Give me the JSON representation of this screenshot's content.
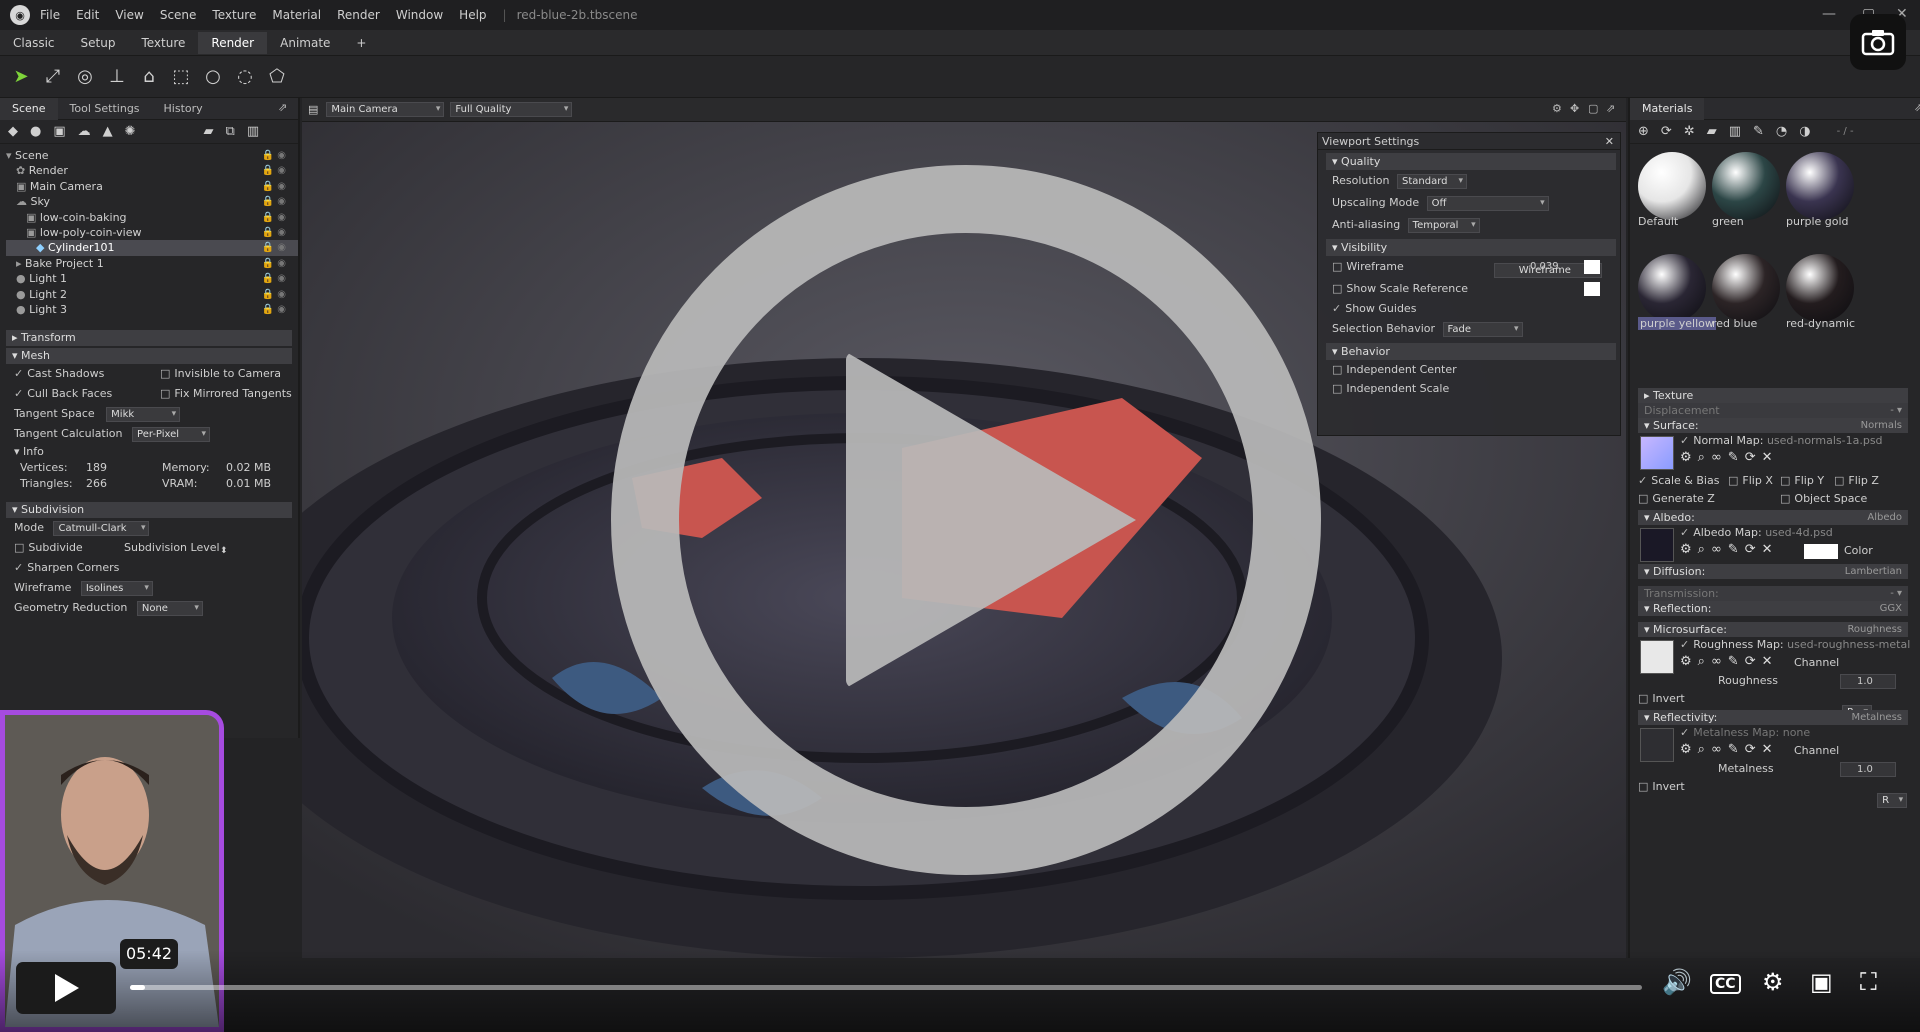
{
  "titlebar": {
    "menu": [
      "File",
      "Edit",
      "View",
      "Scene",
      "Texture",
      "Material",
      "Render",
      "Window",
      "Help"
    ],
    "filename": "red-blue-2b.tbscene"
  },
  "tabs": [
    "Classic",
    "Setup",
    "Texture",
    "Render",
    "Animate",
    "+"
  ],
  "active_tab": "Render",
  "left_panel": {
    "tabs": [
      "Scene",
      "Tool Settings",
      "History"
    ],
    "tree": [
      {
        "label": "Scene",
        "indent": 0
      },
      {
        "label": "Render",
        "indent": 1
      },
      {
        "label": "Main Camera",
        "indent": 1
      },
      {
        "label": "Sky",
        "indent": 1
      },
      {
        "label": "low-coin-baking",
        "indent": 2
      },
      {
        "label": "low-poly-coin-view",
        "indent": 2
      },
      {
        "label": "Cylinder101",
        "indent": 3,
        "selected": true
      },
      {
        "label": "Bake Project 1",
        "indent": 1
      },
      {
        "label": "Light 1",
        "indent": 1
      },
      {
        "label": "Light 2",
        "indent": 1
      },
      {
        "label": "Light 3",
        "indent": 1
      }
    ],
    "sections": {
      "transform": "Transform",
      "mesh": "Mesh",
      "info": "Info",
      "subdivision": "Subdivision"
    },
    "mesh": {
      "cast_shadows": "Cast Shadows",
      "invisible_to_camera": "Invisible to Camera",
      "cull_back_faces": "Cull Back Faces",
      "fix_mirrored": "Fix Mirrored Tangents",
      "tangent_space_label": "Tangent Space",
      "tangent_space_value": "Mikk",
      "tangent_calc_label": "Tangent Calculation",
      "tangent_calc_value": "Per-Pixel"
    },
    "info": {
      "vertices_label": "Vertices:",
      "vertices": "189",
      "triangles_label": "Triangles:",
      "triangles": "266",
      "memory_label": "Memory:",
      "memory": "0.02 MB",
      "vram_label": "VRAM:",
      "vram": "0.01 MB"
    },
    "subdivision": {
      "mode_label": "Mode",
      "mode_value": "Catmull-Clark",
      "subdivide": "Subdivide",
      "level_label": "Subdivision Level",
      "level_value": "1",
      "sharpen": "Sharpen Corners",
      "wireframe_label": "Wireframe",
      "wireframe_value": "Isolines",
      "geo_label": "Geometry Reduction",
      "geo_value": "None"
    }
  },
  "viewport": {
    "camera": "Main Camera",
    "quality": "Full Quality"
  },
  "viewport_settings": {
    "title": "Viewport Settings",
    "quality": "Quality",
    "resolution_label": "Resolution",
    "resolution": "Standard",
    "upscaling_label": "Upscaling Mode",
    "upscaling": "Off",
    "aa_label": "Anti-aliasing",
    "aa": "Temporal",
    "visibility": "Visibility",
    "wireframe_label": "Wireframe",
    "wireframe_field": "Wireframe",
    "wireframe_val": "0.039",
    "scale_ref": "Show Scale Reference",
    "guides": "Show Guides",
    "selection_label": "Selection Behavior",
    "selection": "Fade",
    "behavior": "Behavior",
    "ind_center": "Independent Center",
    "ind_scale": "Independent Scale"
  },
  "materials": {
    "title": "Materials",
    "count": "- / -",
    "items": [
      {
        "label": "Default",
        "color": "#e6e6e6"
      },
      {
        "label": "green",
        "color": "#2c4646"
      },
      {
        "label": "purple gold",
        "color": "#3a3450"
      },
      {
        "label": "purple yellow",
        "color": "#2a2634",
        "selected": true
      },
      {
        "label": "red blue",
        "color": "#2c2426"
      },
      {
        "label": "red-dynamic",
        "color": "#231c1e"
      }
    ]
  },
  "material_props": {
    "texture": "Texture",
    "displacement": "Displacement",
    "surface": "Surface:",
    "surface_val": "Normals",
    "normal_map": "Normal Map:",
    "normal_file": "used-normals-1a.psd",
    "scale_bias": "Scale & Bias",
    "flip_x": "Flip X",
    "flip_y": "Flip Y",
    "flip_z": "Flip Z",
    "generate_z": "Generate Z",
    "object_space": "Object Space",
    "albedo": "Albedo:",
    "albedo_val": "Albedo",
    "albedo_map": "Albedo Map:",
    "albedo_file": "used-4d.psd",
    "color": "Color",
    "diffusion": "Diffusion:",
    "diffusion_val": "Lambertian",
    "transmission": "Transmission:",
    "reflection": "Reflection:",
    "reflection_val": "GGX",
    "microsurface": "Microsurface:",
    "microsurface_val": "Roughness",
    "roughness_map": "Roughness Map:",
    "roughness_file": "used-roughness-metal",
    "channel": "Channel",
    "channel_val": "R",
    "roughness": "Roughness",
    "roughness_val": "1.0",
    "invert": "Invert",
    "reflectivity": "Reflectivity:",
    "reflectivity_val": "Metalness",
    "metal_map": "Metalness Map:",
    "metal_file": "none",
    "metalness": "Metalness",
    "metalness_val": "1.0"
  },
  "video": {
    "timestamp": "05:42",
    "progress": 0.01
  },
  "colors": {
    "accent_green": "#7ed43a",
    "webcam_border": "#a64be0",
    "overlay_gray": "#b9b9b9"
  }
}
